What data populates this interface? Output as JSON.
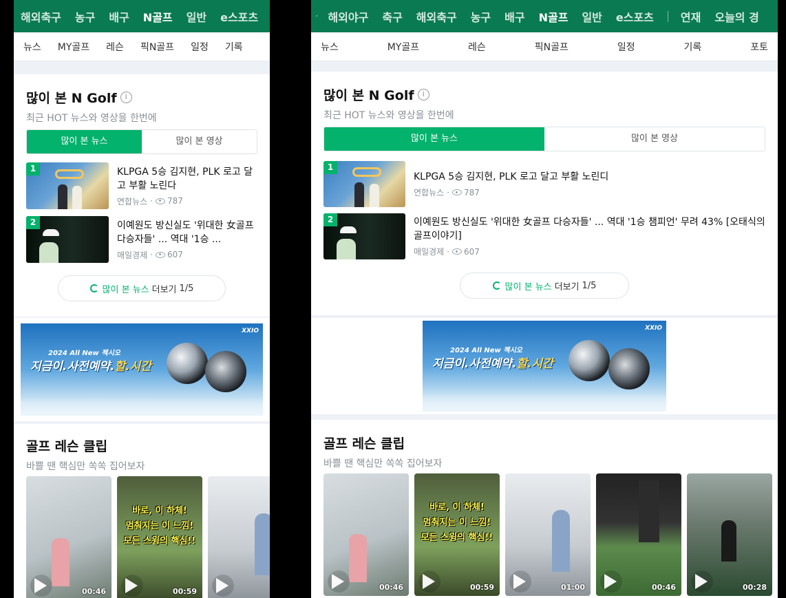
{
  "narrow": {
    "top_nav": [
      "해외축구",
      "농구",
      "배구",
      "N골프",
      "일반",
      "e스포츠"
    ],
    "top_nav_active": "N골프",
    "sub_nav": [
      "뉴스",
      "MY골프",
      "레슨",
      "픽N골프",
      "일정",
      "기록"
    ],
    "news_titles": [
      "KLPGA 5승 김지현, PLK 로고 달고 부활 노린다",
      "이예원도 방신실도 '위대한 女골프 다승자들' ... 역대 '1승 ..."
    ]
  },
  "wide": {
    "top_nav_lead": "·",
    "top_nav": [
      "해외야구",
      "축구",
      "해외축구",
      "농구",
      "배구",
      "N골프",
      "일반",
      "e스포츠"
    ],
    "top_nav_after": [
      "연재",
      "오늘의 경"
    ],
    "top_nav_active": "N골프",
    "sub_nav": [
      "뉴스",
      "MY골프",
      "레슨",
      "픽N골프",
      "일정",
      "기록",
      "포토"
    ],
    "news_titles": [
      "KLPGA 5승 김지현, PLK 로고 달고 부활 노린디",
      "이예원도 방신실도 '위대한 女골프 다승자들' ... 역대 '1승 챔피언' 무려 43% [오태식의 골프이야기]"
    ],
    "extra_clip_durations": [
      "01:00",
      "00:46",
      "00:28"
    ]
  },
  "popular": {
    "title": "많이 본 N Golf",
    "info_icon": "i",
    "subtitle": "최근 HOT 뉴스와 영상을 한번에",
    "tabs": [
      "많이 본 뉴스",
      "많이 본 영상"
    ],
    "news": [
      {
        "rank": "1",
        "source": "연합뉴스",
        "dot": "·",
        "views": "787"
      },
      {
        "rank": "2",
        "source": "매일경제",
        "dot": "·",
        "views": "607"
      }
    ],
    "more_green": "많이 본 뉴스",
    "more_grey": "더보기",
    "more_page": "1/5"
  },
  "banner": {
    "brand": "XXIO",
    "line1": "2024 All New 젝시오",
    "line2_a": "지금이.사전예약.",
    "line2_b": "할.시간"
  },
  "lesson": {
    "title": "골프 레슨 클립",
    "subtitle": "바쁠 땐 핵심만 쏙쏙 집어보자",
    "clip2_text": [
      "바로, 이 하체!",
      "멈춰지는 이 느낌!",
      "모든 스윙의 핵심!!"
    ],
    "durations": [
      "00:46",
      "00:59"
    ]
  },
  "colors": {
    "nav_green": "#0a7a52",
    "accent_green": "#03b26c",
    "page_bg": "#eef1f6"
  }
}
